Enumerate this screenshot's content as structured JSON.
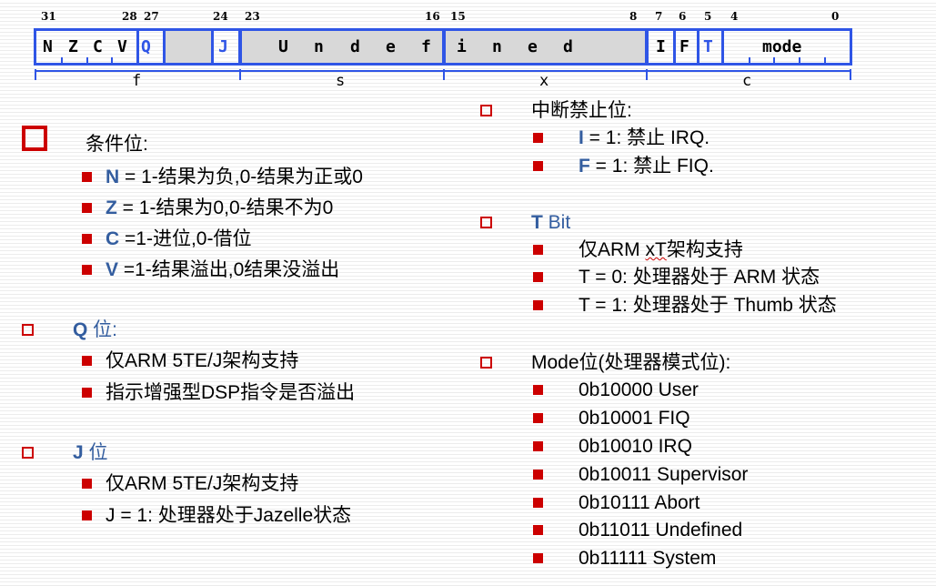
{
  "register": {
    "bit_numbers": [
      "31",
      "28",
      "27",
      "24",
      "23",
      "16",
      "15",
      "8",
      "7",
      "6",
      "5",
      "4",
      "0"
    ],
    "flags_nzcv": [
      "N",
      "Z",
      "C",
      "V"
    ],
    "q": "Q",
    "j": "J",
    "undefined_letters": [
      "U",
      "n",
      "d",
      "e",
      "f",
      "i",
      "n",
      "e",
      "d"
    ],
    "i": "I",
    "f": "F",
    "t": "T",
    "mode": "mode",
    "fields": [
      "f",
      "s",
      "x",
      "c"
    ]
  },
  "left": {
    "cond": {
      "title": "条件位:",
      "items": [
        {
          "key": "N",
          "text": " = 1-结果为负,0-结果为正或0"
        },
        {
          "key": "Z",
          "text": " = 1-结果为0,0-结果不为0"
        },
        {
          "key": "C",
          "text": " =1-进位,0-借位"
        },
        {
          "key": "V",
          "text": " =1-结果溢出,0结果没溢出"
        }
      ]
    },
    "q": {
      "title_key": "Q",
      "title_rest": " 位:",
      "items": [
        "仅ARM 5TE/J架构支持",
        "指示增强型DSP指令是否溢出"
      ]
    },
    "j": {
      "title_key": "J",
      "title_rest": " 位",
      "items": [
        "仅ARM 5TE/J架构支持",
        "J = 1:  处理器处于Jazelle状态"
      ]
    }
  },
  "right": {
    "irq": {
      "title": "中断禁止位:",
      "items": [
        {
          "key": "I",
          "text": "  = 1: 禁止  IRQ."
        },
        {
          "key": "F",
          "text": "  = 1: 禁止  FIQ."
        }
      ]
    },
    "t": {
      "title_key": "T",
      "title_rest": " Bit",
      "item1_pre": "仅ARM  ",
      "item1_squig": "xT",
      "item1_post": "架构支持",
      "items": [
        "T = 0: 处理器处于 ARM 状态",
        "T = 1: 处理器处于 Thumb 状态"
      ]
    },
    "mode": {
      "title": "Mode位(处理器模式位):",
      "items": [
        "0b10000 User",
        "0b10001 FIQ",
        "0b10010 IRQ",
        "0b10011 Supervisor",
        "0b10111 Abort",
        "0b11011 Undefined",
        "0b11111 System"
      ]
    }
  },
  "colors": {
    "register_blue": "#2f55e6",
    "keyword_blue": "#335d9f",
    "bullet_red": "#cc0000"
  }
}
